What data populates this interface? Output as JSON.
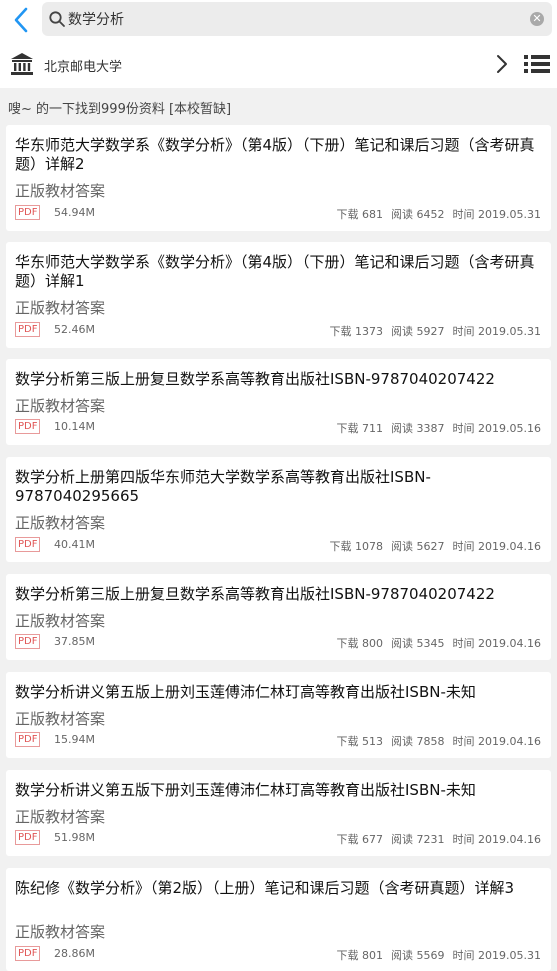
{
  "search": {
    "query": "数学分析"
  },
  "school": {
    "name": "北京邮电大学"
  },
  "result_summary": "嗖~ 的一下找到999份资料 [本校暂缺]",
  "labels": {
    "format": "PDF",
    "download": "下载",
    "read": "阅读",
    "time": "时间"
  },
  "results": [
    {
      "title": "华东师范大学数学系《数学分析》（第4版）（下册）笔记和课后习题（含考研真题）详解2",
      "subtitle": "正版教材答案",
      "size": "54.94M",
      "downloads": "681",
      "reads": "6452",
      "date": "2019.05.31"
    },
    {
      "title": "华东师范大学数学系《数学分析》（第4版）（下册）笔记和课后习题（含考研真题）详解1",
      "subtitle": "正版教材答案",
      "size": "52.46M",
      "downloads": "1373",
      "reads": "5927",
      "date": "2019.05.31"
    },
    {
      "title": "数学分析第三版上册复旦数学系高等教育出版社ISBN-9787040207422",
      "subtitle": "正版教材答案",
      "size": "10.14M",
      "downloads": "711",
      "reads": "3387",
      "date": "2019.05.16"
    },
    {
      "title": "数学分析上册第四版华东师范大学数学系高等教育出版社ISBN-9787040295665",
      "subtitle": "正版教材答案",
      "size": "40.41M",
      "downloads": "1078",
      "reads": "5627",
      "date": "2019.04.16"
    },
    {
      "title": "数学分析第三版上册复旦数学系高等教育出版社ISBN-9787040207422",
      "subtitle": "正版教材答案",
      "size": "37.85M",
      "downloads": "800",
      "reads": "5345",
      "date": "2019.04.16"
    },
    {
      "title": "数学分析讲义第五版上册刘玉莲傅沛仁林玎高等教育出版社ISBN-未知",
      "subtitle": "正版教材答案",
      "size": "15.94M",
      "downloads": "513",
      "reads": "7858",
      "date": "2019.04.16"
    },
    {
      "title": "数学分析讲义第五版下册刘玉莲傅沛仁林玎高等教育出版社ISBN-未知",
      "subtitle": "正版教材答案",
      "size": "51.98M",
      "downloads": "677",
      "reads": "7231",
      "date": "2019.04.16"
    },
    {
      "title": "陈纪修《数学分析》（第2版）（上册）笔记和课后习题（含考研真题）详解3",
      "subtitle": "正版教材答案",
      "size": "28.86M",
      "downloads": "801",
      "reads": "5569",
      "date": "2019.05.31"
    }
  ],
  "colors": {
    "accent": "#2196f3",
    "pdf_red": "#e05555",
    "background": "#f1f1f1"
  },
  "icons": {
    "back": "chevron-left-icon",
    "search": "search-icon",
    "clear": "clear-icon",
    "school": "bank-icon",
    "next": "chevron-right-icon",
    "menu": "list-icon"
  }
}
